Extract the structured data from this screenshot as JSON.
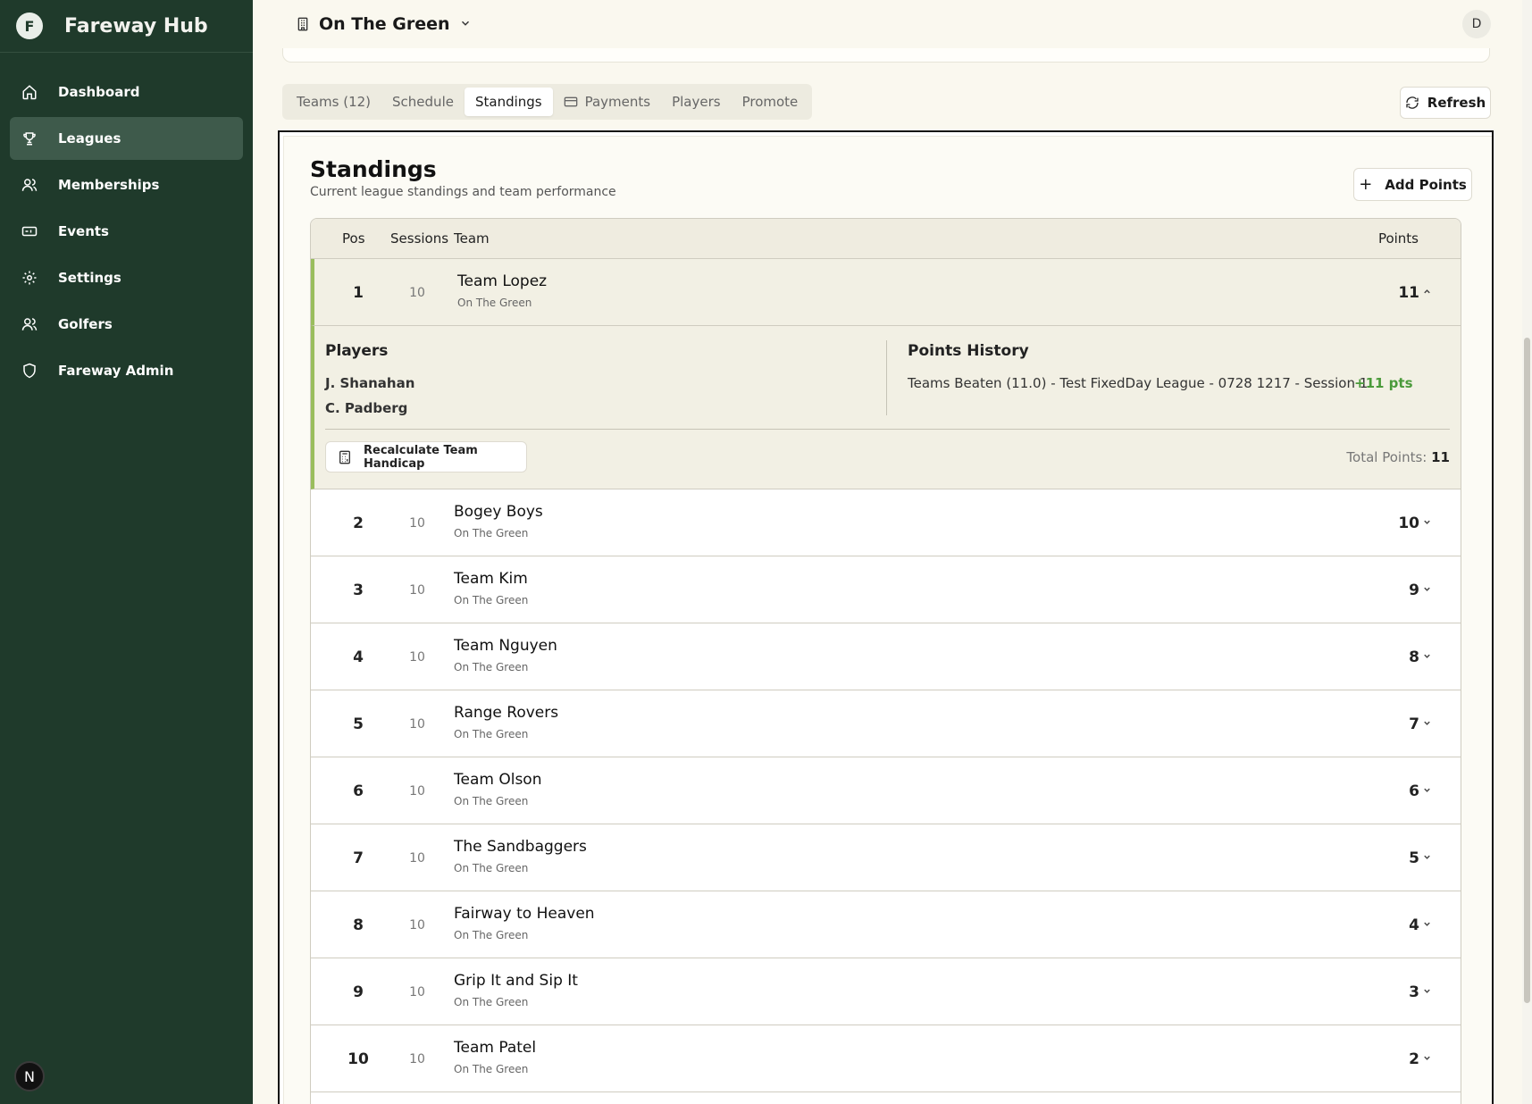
{
  "app": {
    "name": "Fareway Hub",
    "logo_letter": "F"
  },
  "sidebar": {
    "items": [
      {
        "label": "Dashboard",
        "icon": "home-icon"
      },
      {
        "label": "Leagues",
        "icon": "trophy-icon",
        "active": true
      },
      {
        "label": "Memberships",
        "icon": "users-icon"
      },
      {
        "label": "Events",
        "icon": "ticket-icon"
      },
      {
        "label": "Settings",
        "icon": "gear-icon"
      },
      {
        "label": "Golfers",
        "icon": "users-icon"
      },
      {
        "label": "Fareway Admin",
        "icon": "shield-icon"
      }
    ],
    "footer_badge": "N"
  },
  "header": {
    "venue": "On The Green",
    "avatar_initial": "D"
  },
  "tabs": [
    {
      "label": "Teams (12)"
    },
    {
      "label": "Schedule"
    },
    {
      "label": "Standings",
      "active": true
    },
    {
      "label": "Payments",
      "icon": "card-icon"
    },
    {
      "label": "Players"
    },
    {
      "label": "Promote"
    }
  ],
  "refresh_label": "Refresh",
  "standings": {
    "title": "Standings",
    "subtitle": "Current league standings and team performance",
    "add_points_label": "Add Points",
    "columns": {
      "pos": "Pos",
      "sessions": "Sessions",
      "team": "Team",
      "points": "Points"
    },
    "expanded": {
      "players_title": "Players",
      "players": [
        "J. Shanahan",
        "C. Padberg"
      ],
      "history_title": "Points History",
      "history": [
        {
          "text": "Teams Beaten (11.0) - Test FixedDay League - 0728 1217 - Session 1",
          "points": "+11 pts"
        }
      ],
      "recalc_label": "Recalculate Team Handicap",
      "total_label": "Total Points:",
      "total_value": "11"
    },
    "rows": [
      {
        "pos": "1",
        "sessions": "10",
        "team": "Team Lopez",
        "venue": "On The Green",
        "points": "11"
      },
      {
        "pos": "2",
        "sessions": "10",
        "team": "Bogey Boys",
        "venue": "On The Green",
        "points": "10"
      },
      {
        "pos": "3",
        "sessions": "10",
        "team": "Team Kim",
        "venue": "On The Green",
        "points": "9"
      },
      {
        "pos": "4",
        "sessions": "10",
        "team": "Team Nguyen",
        "venue": "On The Green",
        "points": "8"
      },
      {
        "pos": "5",
        "sessions": "10",
        "team": "Range Rovers",
        "venue": "On The Green",
        "points": "7"
      },
      {
        "pos": "6",
        "sessions": "10",
        "team": "Team Olson",
        "venue": "On The Green",
        "points": "6"
      },
      {
        "pos": "7",
        "sessions": "10",
        "team": "The Sandbaggers",
        "venue": "On The Green",
        "points": "5"
      },
      {
        "pos": "8",
        "sessions": "10",
        "team": "Fairway to Heaven",
        "venue": "On The Green",
        "points": "4"
      },
      {
        "pos": "9",
        "sessions": "10",
        "team": "Grip It and Sip It",
        "venue": "On The Green",
        "points": "3"
      },
      {
        "pos": "10",
        "sessions": "10",
        "team": "Team Patel",
        "venue": "On The Green",
        "points": "2"
      }
    ]
  },
  "colors": {
    "sidebar": "#1f3a2b",
    "accent": "#9abd5d",
    "positive": "#4a9a3a"
  }
}
